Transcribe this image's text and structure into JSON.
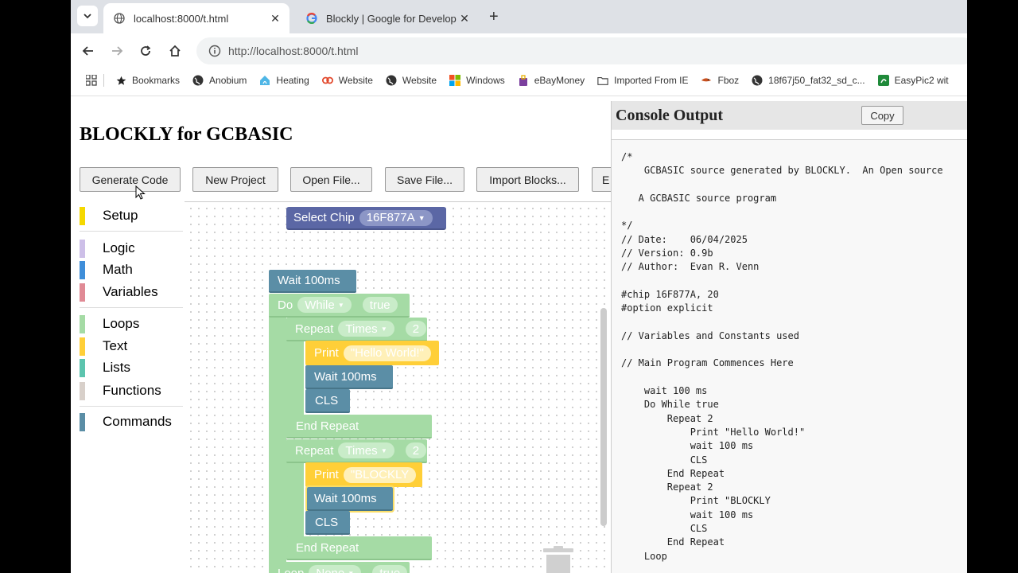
{
  "browser": {
    "tabs": [
      {
        "title": "localhost:8000/t.html",
        "active": true
      },
      {
        "title": "Blockly | Google for Developers",
        "active": false
      }
    ],
    "url": "http://localhost:8000/t.html",
    "bookmarks": [
      {
        "label": "Bookmarks",
        "icon": "star-icon"
      },
      {
        "label": "Anobium",
        "icon": "globe-icon"
      },
      {
        "label": "Heating",
        "icon": "heating-icon"
      },
      {
        "label": "Website",
        "icon": "link-icon"
      },
      {
        "label": "Website",
        "icon": "globe-icon"
      },
      {
        "label": "Windows",
        "icon": "windows-icon"
      },
      {
        "label": "eBayMoney",
        "icon": "bag-icon"
      },
      {
        "label": "Imported From IE",
        "icon": "folder-icon"
      },
      {
        "label": "Fboz",
        "icon": "bird-icon"
      },
      {
        "label": "18f67j50_fat32_sd_c...",
        "icon": "globe-icon"
      },
      {
        "label": "EasyPic2 wit",
        "icon": "chip-icon"
      }
    ]
  },
  "page": {
    "title": "BLOCKLY for GCBASIC",
    "buttons": [
      "Generate Code",
      "New Project",
      "Open File...",
      "Save File...",
      "Import Blocks...",
      "E"
    ]
  },
  "toolbox": {
    "categories": [
      {
        "label": "Setup",
        "color": "#f5d800"
      },
      {
        "label": "Logic",
        "color": "#cdbfe8"
      },
      {
        "label": "Math",
        "color": "#3f8ed9"
      },
      {
        "label": "Variables",
        "color": "#e08a95"
      },
      {
        "label": "Loops",
        "color": "#a5dba5"
      },
      {
        "label": "Text",
        "color": "#ffcf38"
      },
      {
        "label": "Lists",
        "color": "#5cc4ae"
      },
      {
        "label": "Functions",
        "color": "#d8d0ca"
      },
      {
        "label": "Commands",
        "color": "#5b8ea6"
      }
    ]
  },
  "blocks": {
    "select_chip": {
      "label": "Select Chip",
      "value": "16F877A"
    },
    "wait1": "Wait 100ms",
    "do_label": "Do",
    "do_mode": "While",
    "do_cond": "true",
    "repeat1": {
      "label": "Repeat",
      "mode": "Times",
      "count": "2"
    },
    "print1": {
      "label": "Print",
      "value": "\"Hello World!\""
    },
    "wait2": "Wait 100ms",
    "cls1": "CLS",
    "end_repeat1": "End Repeat",
    "repeat2": {
      "label": "Repeat",
      "mode": "Times",
      "count": "2"
    },
    "print2": {
      "label": "Print",
      "value": "\"BLOCKLY"
    },
    "wait3": "Wait 100ms",
    "cls2": "CLS",
    "end_repeat2": "End Repeat",
    "loop": {
      "label": "Loop",
      "mode": "None",
      "cond": "true"
    }
  },
  "console": {
    "title": "Console Output",
    "copy_label": "Copy",
    "text": "/*\n    GCBASIC source generated by BLOCKLY.  An Open source\n\n   A GCBASIC source program\n\n*/\n// Date:    06/04/2025\n// Version: 0.9b\n// Author:  Evan R. Venn\n\n#chip 16F877A, 20\n#option explicit\n\n// Variables and Constants used\n\n// Main Program Commences Here\n\n    wait 100 ms\n    Do While true\n        Repeat 2\n            Print \"Hello World!\"\n            wait 100 ms\n            CLS\n        End Repeat\n        Repeat 2\n            Print \"BLOCKLY\n            wait 100 ms\n            CLS\n        End Repeat\n    Loop"
  }
}
